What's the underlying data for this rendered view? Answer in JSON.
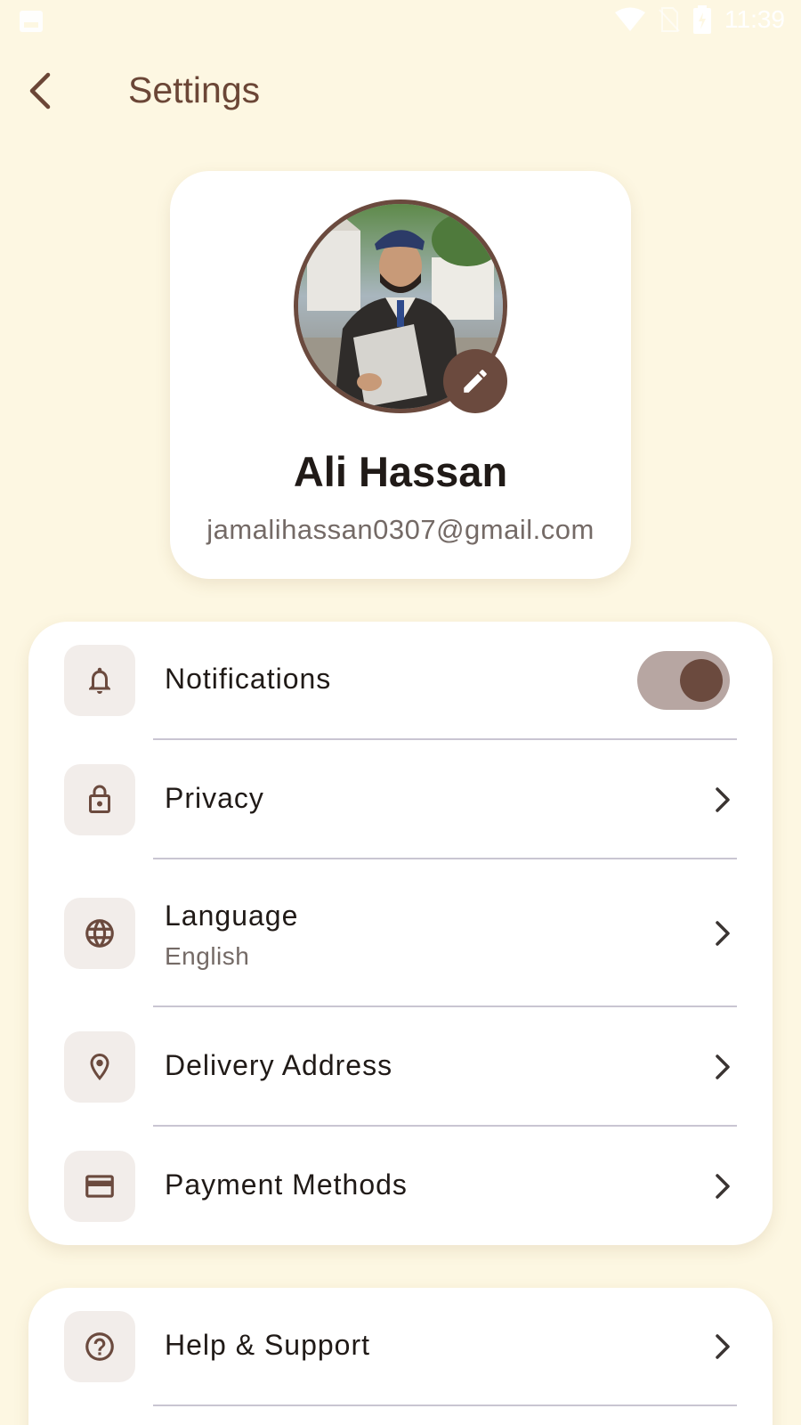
{
  "status_bar": {
    "time": "11:39"
  },
  "app_bar": {
    "title": "Settings"
  },
  "profile": {
    "name": "Ali Hassan",
    "email": "jamalihassan0307@gmail.com"
  },
  "settings": {
    "notifications": {
      "label": "Notifications",
      "enabled": true,
      "icon": "bell-icon"
    },
    "privacy": {
      "label": "Privacy",
      "icon": "lock-icon"
    },
    "language": {
      "label": "Language",
      "value": "English",
      "icon": "globe-icon"
    },
    "delivery_address": {
      "label": "Delivery Address",
      "icon": "location-pin-icon"
    },
    "payment_methods": {
      "label": "Payment Methods",
      "icon": "credit-card-icon"
    }
  },
  "support": {
    "help": {
      "label": "Help & Support",
      "icon": "help-circle-icon"
    }
  },
  "colors": {
    "background": "#FDF7E2",
    "accent": "#6B4A3E",
    "title": "#6B4636",
    "card": "#FFFFFF"
  }
}
